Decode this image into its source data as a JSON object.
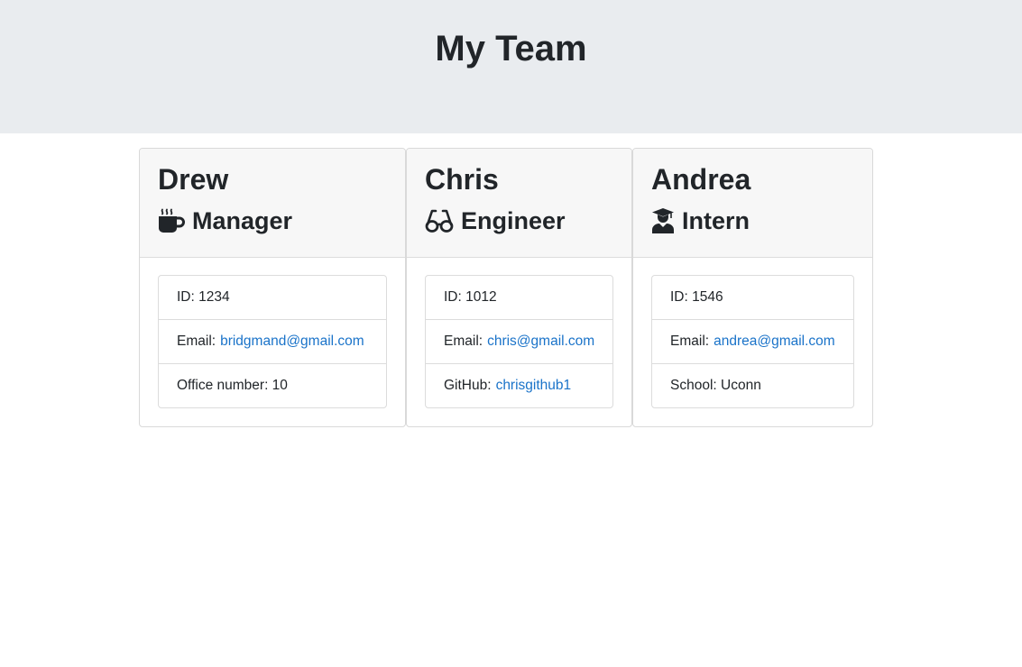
{
  "header": {
    "title": "My Team"
  },
  "cards": [
    {
      "name": "Drew",
      "role": "Manager",
      "icon": "coffee-mug-icon",
      "id_label": "ID: 1234",
      "email_label": "Email:",
      "email": "bridgmand@gmail.com",
      "extra_text": "Office number: 10"
    },
    {
      "name": "Chris",
      "role": "Engineer",
      "icon": "glasses-icon",
      "id_label": "ID: 1012",
      "email_label": "Email:",
      "email": "chris@gmail.com",
      "extra_label": "GitHub:",
      "extra_link": "chrisgithub1"
    },
    {
      "name": "Andrea",
      "role": "Intern",
      "icon": "graduate-icon",
      "id_label": "ID: 1546",
      "email_label": "Email:",
      "email": "andrea@gmail.com",
      "extra_text": "School: Uconn"
    }
  ],
  "colors": {
    "header_bg": "#e9ecef",
    "card_header_bg": "#f7f7f7",
    "link": "#1a73c9",
    "text": "#212529"
  }
}
